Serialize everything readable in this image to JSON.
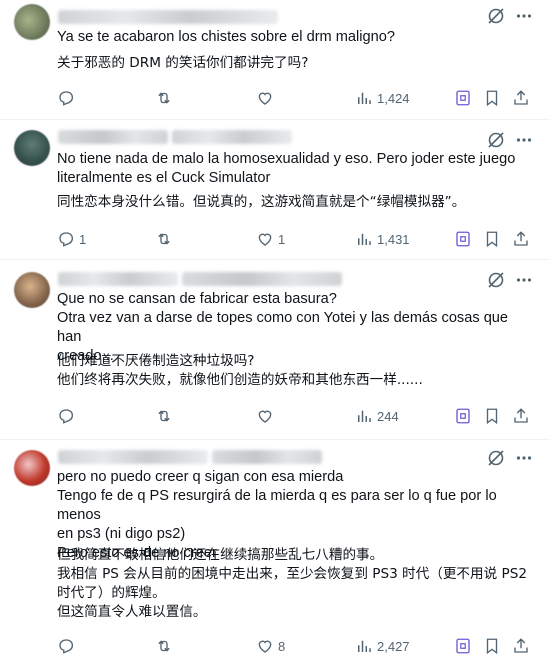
{
  "posts": [
    {
      "lines_es": "Ya se te acabaron los chistes sobre el drm maligno?",
      "lines_zh": "关于邪恶的 DRM 的笑话你们都讲完了吗?",
      "replies": "",
      "retweets": "",
      "likes": "",
      "views": "1,424"
    },
    {
      "lines_es": "No tiene nada de malo la homosexualidad y eso. Pero joder este juego\nliteralmente es el Cuck Simulator",
      "lines_zh": "同性恋本身没什么错。但说真的，这游戏简直就是个“绿帽模拟器”。",
      "replies": "1",
      "retweets": "",
      "likes": "1",
      "views": "1,431"
    },
    {
      "lines_es": "Que no se cansan de fabricar esta basura?\nOtra vez van a darse de topes como con Yotei y las demás cosas que han\ncreado...",
      "lines_zh": "他们难道不厌倦制造这种垃圾吗?\n他们终将再次失败，就像他们创造的妖帝和其他东西一样......",
      "replies": "",
      "retweets": "",
      "likes": "",
      "views": "244"
    },
    {
      "lines_es": "pero no puedo creer q sigan con esa mierda\nTengo fe de q PS resurgirá de la mierda q es para ser lo q fue por lo menos\nen ps3 (ni digo ps2)\nPero esto es de no creer",
      "lines_zh": "但我简直不敢相信他们还在继续搞那些乱七八糟的事。\n我相信 PS 会从目前的困境中走出来，至少会恢复到 PS3 时代（更不用说 PS2\n时代了）的辉煌。\n但这简直令人难以置信。",
      "replies": "",
      "retweets": "",
      "likes": "8",
      "views": "2,427"
    }
  ],
  "colors": {
    "icon": "#536471",
    "grok_accent": "#6b5bd6",
    "divider": "#eff3f4"
  },
  "icons": [
    "reply-icon",
    "retweet-icon",
    "like-icon",
    "views-icon",
    "grok-icon",
    "bookmark-icon",
    "share-icon",
    "more-icon"
  ]
}
